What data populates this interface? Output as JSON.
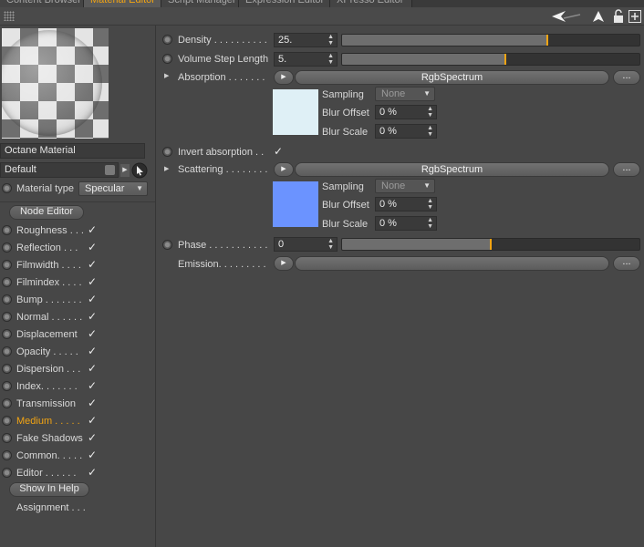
{
  "tabs": [
    {
      "label": "Content Browser",
      "active": false
    },
    {
      "label": "Material Editor",
      "active": true
    },
    {
      "label": "Script Manager",
      "active": false
    },
    {
      "label": "Expression Editor",
      "active": false
    },
    {
      "label": "XPresso Editor",
      "active": false
    }
  ],
  "toolbar": {
    "icons": [
      "grip-icon",
      "back-arrow-icon",
      "pointer-icon",
      "lock-icon",
      "new-panel-icon"
    ]
  },
  "sidebar": {
    "material_name": "Octane Material",
    "layer": "Default",
    "material_type_label": "Material type",
    "material_type_value": "Specular",
    "node_editor": "Node Editor",
    "channels": [
      {
        "label": "Roughness . . .",
        "checked": true,
        "active": false
      },
      {
        "label": "Reflection . . .",
        "checked": true,
        "active": false
      },
      {
        "label": "Filmwidth . . . .",
        "checked": true,
        "active": false
      },
      {
        "label": "Filmindex . . . .",
        "checked": true,
        "active": false
      },
      {
        "label": "Bump . . . . . . .",
        "checked": true,
        "active": false
      },
      {
        "label": "Normal . . . . . .",
        "checked": true,
        "active": false
      },
      {
        "label": "Displacement",
        "checked": true,
        "active": false
      },
      {
        "label": "Opacity . . . . .",
        "checked": true,
        "active": false
      },
      {
        "label": "Dispersion . . .",
        "checked": true,
        "active": false
      },
      {
        "label": "Index. . . . . . .",
        "checked": true,
        "active": false
      },
      {
        "label": "Transmission",
        "checked": true,
        "active": false
      },
      {
        "label": "Medium . . . . .",
        "checked": true,
        "active": true
      },
      {
        "label": "Fake Shadows",
        "checked": true,
        "active": false
      },
      {
        "label": "Common. . . . .",
        "checked": true,
        "active": false
      },
      {
        "label": "Editor . . . . . .",
        "checked": true,
        "active": false
      }
    ],
    "show_in_help": "Show In Help",
    "assignment": "Assignment . . ."
  },
  "medium": {
    "density_label": "Density . . . . . . . . . .",
    "density_value": "25.",
    "density_slider": 0.69,
    "step_label": "Volume Step Length",
    "step_value": "5.",
    "step_slider": 0.55,
    "absorption_label": "Absorption . . . . . . .",
    "absorption_shader": "RgbSpectrum",
    "absorption_color": "#dff0f6",
    "sampling_label": "Sampling",
    "sampling_value": "None",
    "blur_offset_label": "Blur Offset",
    "blur_offset_value": "0 %",
    "blur_scale_label": "Blur Scale",
    "blur_scale_value": "0 %",
    "invert_label": "Invert absorption . .",
    "invert_checked": true,
    "scattering_label": "Scattering . . . . . . . .",
    "scattering_shader": "RgbSpectrum",
    "scattering_color": "#6b93ff",
    "phase_label": "Phase . . . . . . . . . . .",
    "phase_value": "0",
    "phase_slider": 0.5,
    "emission_label": "Emission. . . . . . . . .",
    "more_label": "...",
    "check_glyph": "✓"
  }
}
